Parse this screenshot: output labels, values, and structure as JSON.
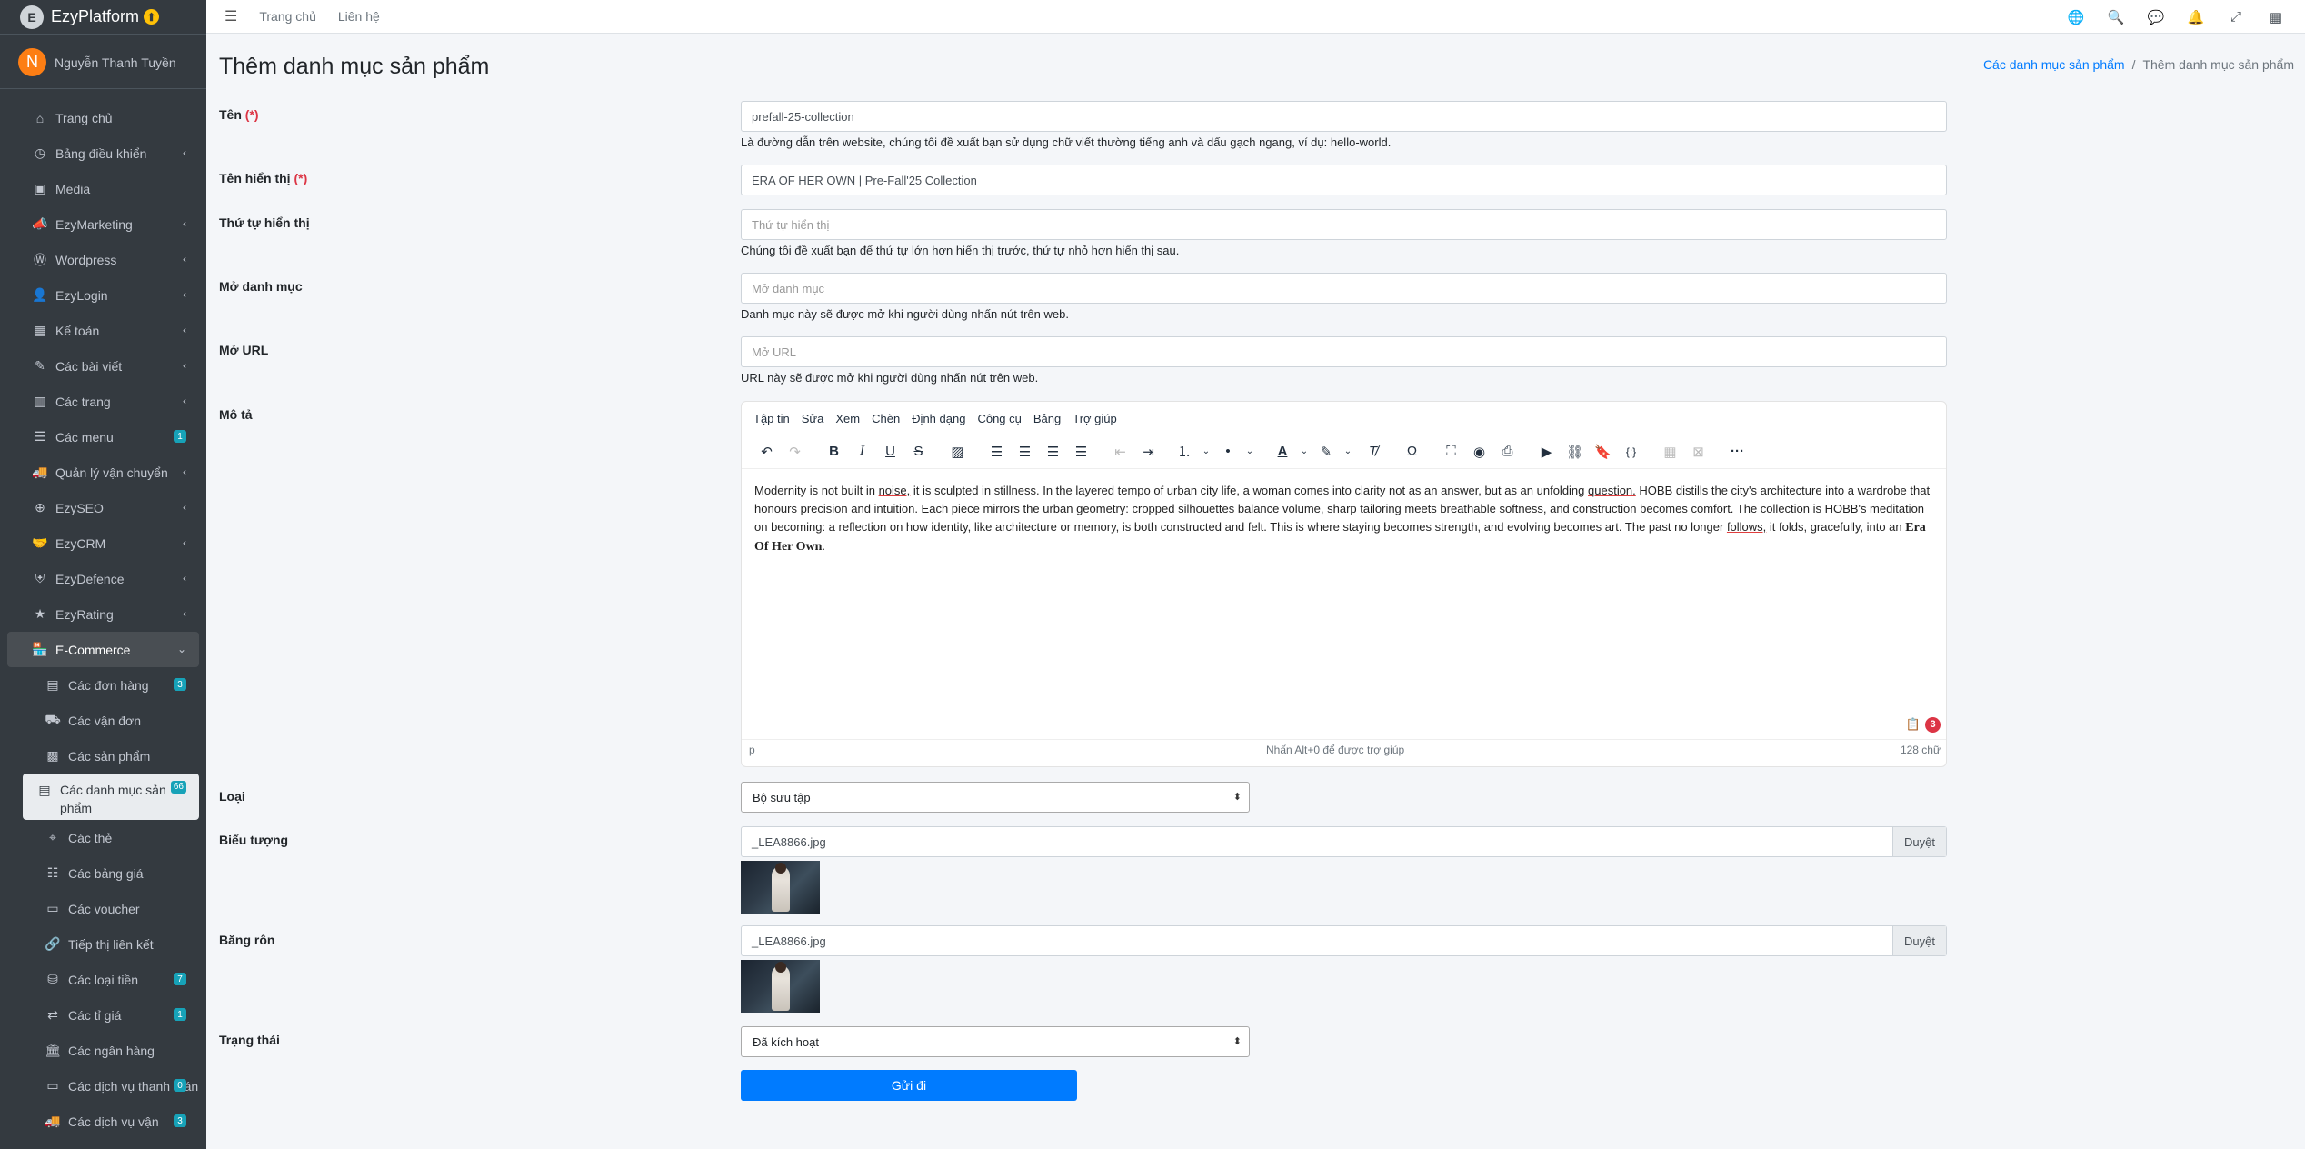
{
  "brand": {
    "name": "EzyPlatform",
    "logo": "E",
    "badge": "⬆"
  },
  "user": {
    "initial": "N",
    "name": "Nguyễn Thanh Tuyền"
  },
  "sidebar": {
    "items": [
      {
        "label": "Trang chủ",
        "icon": "home-icon",
        "glyph": "⌂"
      },
      {
        "label": "Bảng điều khiển",
        "icon": "tachometer-icon",
        "glyph": "◷",
        "caret": "‹"
      },
      {
        "label": "Media",
        "icon": "image-icon",
        "glyph": "▣"
      },
      {
        "label": "EzyMarketing",
        "icon": "bullhorn-icon",
        "glyph": "📣",
        "caret": "‹"
      },
      {
        "label": "Wordpress",
        "icon": "wordpress-icon",
        "glyph": "Ⓦ",
        "caret": "‹"
      },
      {
        "label": "EzyLogin",
        "icon": "user-lock-icon",
        "glyph": "👤",
        "caret": "‹"
      },
      {
        "label": "Kế toán",
        "icon": "calculator-icon",
        "glyph": "▦",
        "caret": "‹"
      },
      {
        "label": "Các bài viết",
        "icon": "edit-icon",
        "glyph": "✎",
        "caret": "‹"
      },
      {
        "label": "Các trang",
        "icon": "columns-icon",
        "glyph": "▥",
        "caret": "‹"
      },
      {
        "label": "Các menu",
        "icon": "bars-icon",
        "glyph": "☰",
        "count": "1"
      },
      {
        "label": "Quản lý vận chuyển",
        "icon": "truck-icon",
        "glyph": "🚚",
        "caret": "‹"
      },
      {
        "label": "EzySEO",
        "icon": "search-plus-icon",
        "glyph": "⊕",
        "caret": "‹"
      },
      {
        "label": "EzyCRM",
        "icon": "handshake-icon",
        "glyph": "🤝",
        "caret": "‹"
      },
      {
        "label": "EzyDefence",
        "icon": "shield-icon",
        "glyph": "⛨",
        "caret": "‹"
      },
      {
        "label": "EzyRating",
        "icon": "star-icon",
        "glyph": "★",
        "caret": "‹"
      },
      {
        "label": "E-Commerce",
        "icon": "store-icon",
        "glyph": "🏪",
        "caret": "⌄"
      }
    ],
    "sub": [
      {
        "label": "Các đơn hàng",
        "icon": "file-invoice-icon",
        "glyph": "▤",
        "count": "3"
      },
      {
        "label": "Các vận đơn",
        "icon": "shipping-icon",
        "glyph": "⛟"
      },
      {
        "label": "Các sản phẩm",
        "icon": "boxes-icon",
        "glyph": "▩"
      },
      {
        "label": "Các danh mục sản phẩm",
        "icon": "clipboard-list-icon",
        "glyph": "▤",
        "count": "66"
      },
      {
        "label": "Các thẻ",
        "icon": "tags-icon",
        "glyph": "⌖"
      },
      {
        "label": "Các bảng giá",
        "icon": "list-icon",
        "glyph": "☷"
      },
      {
        "label": "Các voucher",
        "icon": "ticket-icon",
        "glyph": "▭"
      },
      {
        "label": "Tiếp thị liên kết",
        "icon": "link-icon",
        "glyph": "🔗"
      },
      {
        "label": "Các loại tiền",
        "icon": "coins-icon",
        "glyph": "⛁",
        "count": "7"
      },
      {
        "label": "Các tỉ giá",
        "icon": "exchange-icon",
        "glyph": "⇄",
        "count": "1"
      },
      {
        "label": "Các ngân hàng",
        "icon": "bank-icon",
        "glyph": "🏛"
      },
      {
        "label": "Các dịch vụ thanh toán",
        "icon": "credit-card-icon",
        "glyph": "▭",
        "count": "0"
      },
      {
        "label": "Các dịch vụ vận",
        "icon": "truck-icon",
        "glyph": "🚚",
        "count": "3"
      }
    ]
  },
  "topbar": {
    "links": [
      "Trang chủ",
      "Liên hệ"
    ],
    "icons": [
      {
        "name": "globe-icon",
        "glyph": "🌐"
      },
      {
        "name": "search-icon",
        "glyph": "🔍"
      },
      {
        "name": "comments-icon",
        "glyph": "💬"
      },
      {
        "name": "bell-icon",
        "glyph": "🔔"
      },
      {
        "name": "fullscreen-icon",
        "glyph": "⤢"
      },
      {
        "name": "apps-icon",
        "glyph": "▦"
      }
    ]
  },
  "page": {
    "title": "Thêm danh mục sản phẩm"
  },
  "breadcrumb": {
    "parent": "Các danh mục sản phẩm",
    "current": "Thêm danh mục sản phẩm",
    "sep": "/"
  },
  "form": {
    "name": {
      "label": "Tên",
      "req": "(*)",
      "value": "prefall-25-collection",
      "help": "Là đường dẫn trên website, chúng tôi đề xuất bạn sử dụng chữ viết thường tiếng anh và dấu gạch ngang, ví dụ: hello-world."
    },
    "display_name": {
      "label": "Tên hiển thị",
      "req": "(*)",
      "value": "ERA OF HER OWN | Pre-Fall'25 Collection"
    },
    "order": {
      "label": "Thứ tự hiển thị",
      "placeholder": "Thứ tự hiển thị",
      "help": "Chúng tôi đề xuất bạn để thứ tự lớn hơn hiển thị trước, thứ tự nhỏ hơn hiển thị sau."
    },
    "open_category": {
      "label": "Mở danh mục",
      "placeholder": "Mở danh mục",
      "help": "Danh mục này sẽ được mở khi người dùng nhấn nút trên web."
    },
    "open_url": {
      "label": "Mở URL",
      "placeholder": "Mở URL",
      "help": "URL này sẽ được mở khi người dùng nhấn nút trên web."
    },
    "description": {
      "label": "Mô tả"
    },
    "type": {
      "label": "Loại",
      "value": "Bộ sưu tập"
    },
    "icon": {
      "label": "Biểu tượng",
      "file": "_LEA8866.jpg",
      "browse": "Duyệt"
    },
    "banner": {
      "label": "Băng rôn",
      "file": "_LEA8866.jpg",
      "browse": "Duyệt"
    },
    "status": {
      "label": "Trạng thái",
      "value": "Đã kích hoạt"
    },
    "submit": "Gửi đi"
  },
  "editor": {
    "menu": [
      "Tập tin",
      "Sửa",
      "Xem",
      "Chèn",
      "Định dạng",
      "Công cụ",
      "Bảng",
      "Trợ giúp"
    ],
    "text": {
      "p1": "Modernity is not built in ",
      "w_noise": "noise,",
      "p2": " it is sculpted in stillness. In the layered tempo of urban city life, a woman comes into clarity not as an answer, but as an unfolding ",
      "w_question": "question.",
      "p3": " HOBB distills the city's architecture into a wardrobe that honours precision and intuition. Each piece mirrors the urban geometry: cropped silhouettes balance volume, sharp tailoring meets breathable softness, and construction becomes comfort. The collection is HOBB's meditation on becoming: a reflection on how identity, like architecture or memory, is both constructed and felt. This is where staying becomes strength, and evolving becomes art. The past no longer ",
      "w_follows": "follows,",
      "p4": " it folds, gracefully, into an ",
      "era": "Era Of Her Own",
      "end": "."
    },
    "status_path": "p",
    "status_hint": "Nhấn Alt+0 để được trợ giúp",
    "word_count": "128 chữ",
    "grammar_count": "3"
  }
}
